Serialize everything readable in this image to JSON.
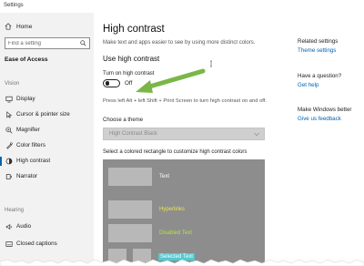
{
  "window": {
    "title": "Settings"
  },
  "sidebar": {
    "home_label": "Home",
    "search_placeholder": "Find a setting",
    "section_title": "Ease of Access",
    "groups": [
      {
        "label": "Vision"
      },
      {
        "label": "Hearing"
      }
    ],
    "items": [
      {
        "label": "Display",
        "icon": "display-icon"
      },
      {
        "label": "Cursor & pointer size",
        "icon": "cursor-icon"
      },
      {
        "label": "Magnifier",
        "icon": "magnifier-icon"
      },
      {
        "label": "Color filters",
        "icon": "color-filters-icon"
      },
      {
        "label": "High contrast",
        "icon": "high-contrast-icon",
        "active": true
      },
      {
        "label": "Narrator",
        "icon": "narrator-icon"
      },
      {
        "label": "Audio",
        "icon": "audio-icon"
      },
      {
        "label": "Closed captions",
        "icon": "captions-icon"
      }
    ]
  },
  "main": {
    "title": "High contrast",
    "description": "Make text and apps easier to see by using more distinct colors.",
    "subheading": "Use high contrast",
    "toggle_label": "Turn on high contrast",
    "toggle_state": "Off",
    "hint": "Press left Alt + left Shift + Print Screen to turn high contrast on and off.",
    "choose_theme_label": "Choose a theme",
    "theme_value": "High Contrast Black",
    "rect_label": "Select a colored rectangle to customize high contrast colors",
    "preview": {
      "text": "Text",
      "hyperlinks": "Hyperlinks",
      "disabled_text": "Disabled Text",
      "selected_text": "Selected Text"
    }
  },
  "aside": {
    "related_heading": "Related settings",
    "related_link": "Theme settings",
    "question_heading": "Have a question?",
    "question_link": "Get help",
    "better_heading": "Make Windows better",
    "better_link": "Give us feedback"
  },
  "colors": {
    "accent": "#0063b1",
    "arrow": "#7ab648",
    "preview_bg": "#8d8d8d",
    "hyperlink": "#e8e45a",
    "disabled": "#b8e04a",
    "selected_bg": "#53c9d0"
  }
}
